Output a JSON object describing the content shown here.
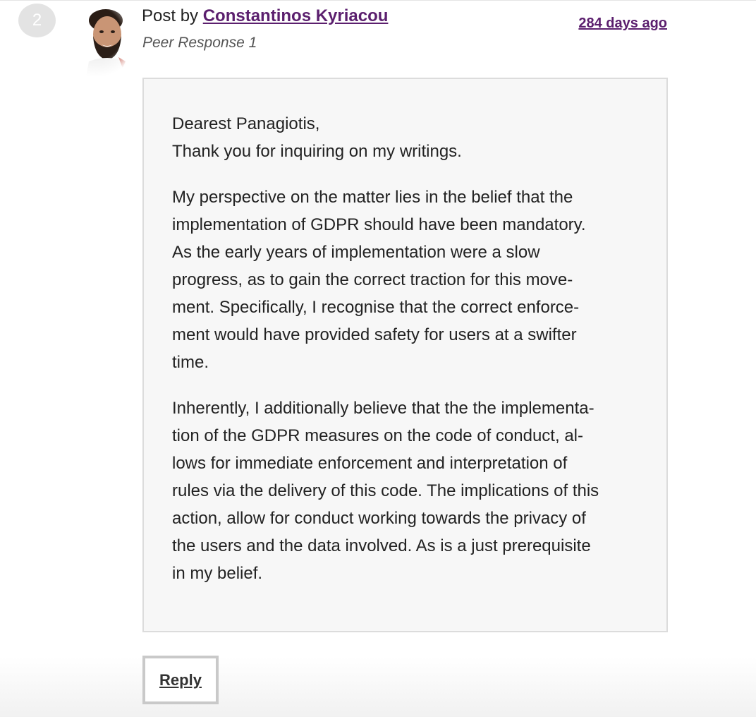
{
  "post": {
    "number": "2",
    "author_prefix": "Post by",
    "author_name": "Constantinos Kyriacou",
    "subject": "Peer Response 1",
    "time_ago": "284 days ago",
    "avatar_icon": "user-avatar-photo"
  },
  "body": {
    "greeting_lines": [
      "Dearest Panagiotis,",
      "Thank you for inquiring on my writings."
    ],
    "paragraph1_lines": [
      "My perspective on the matter lies in the belief that the",
      "implementation of GDPR should have been mandatory.",
      "As the early years of implementation were a slow",
      "progress, as to gain the correct traction for this move-",
      "ment. Specifically, I recognise that the correct enforce-",
      "ment would have provided safety for users at a swifter",
      "time."
    ],
    "paragraph2_lines": [
      "Inherently, I additionally believe that the the implementa-",
      "tion of the GDPR measures on the code of conduct, al-",
      "lows for immediate enforcement and interpretation of",
      "rules via the delivery of this code. The implications of this",
      "action, allow for conduct working towards the privacy of",
      "the users and the data involved. As is a just prerequisite",
      "in my belief."
    ]
  },
  "actions": {
    "reply_label": "Reply"
  },
  "colors": {
    "link": "#5b1f6e",
    "body_background": "#f7f7f7",
    "body_border": "#dcdcdc"
  }
}
